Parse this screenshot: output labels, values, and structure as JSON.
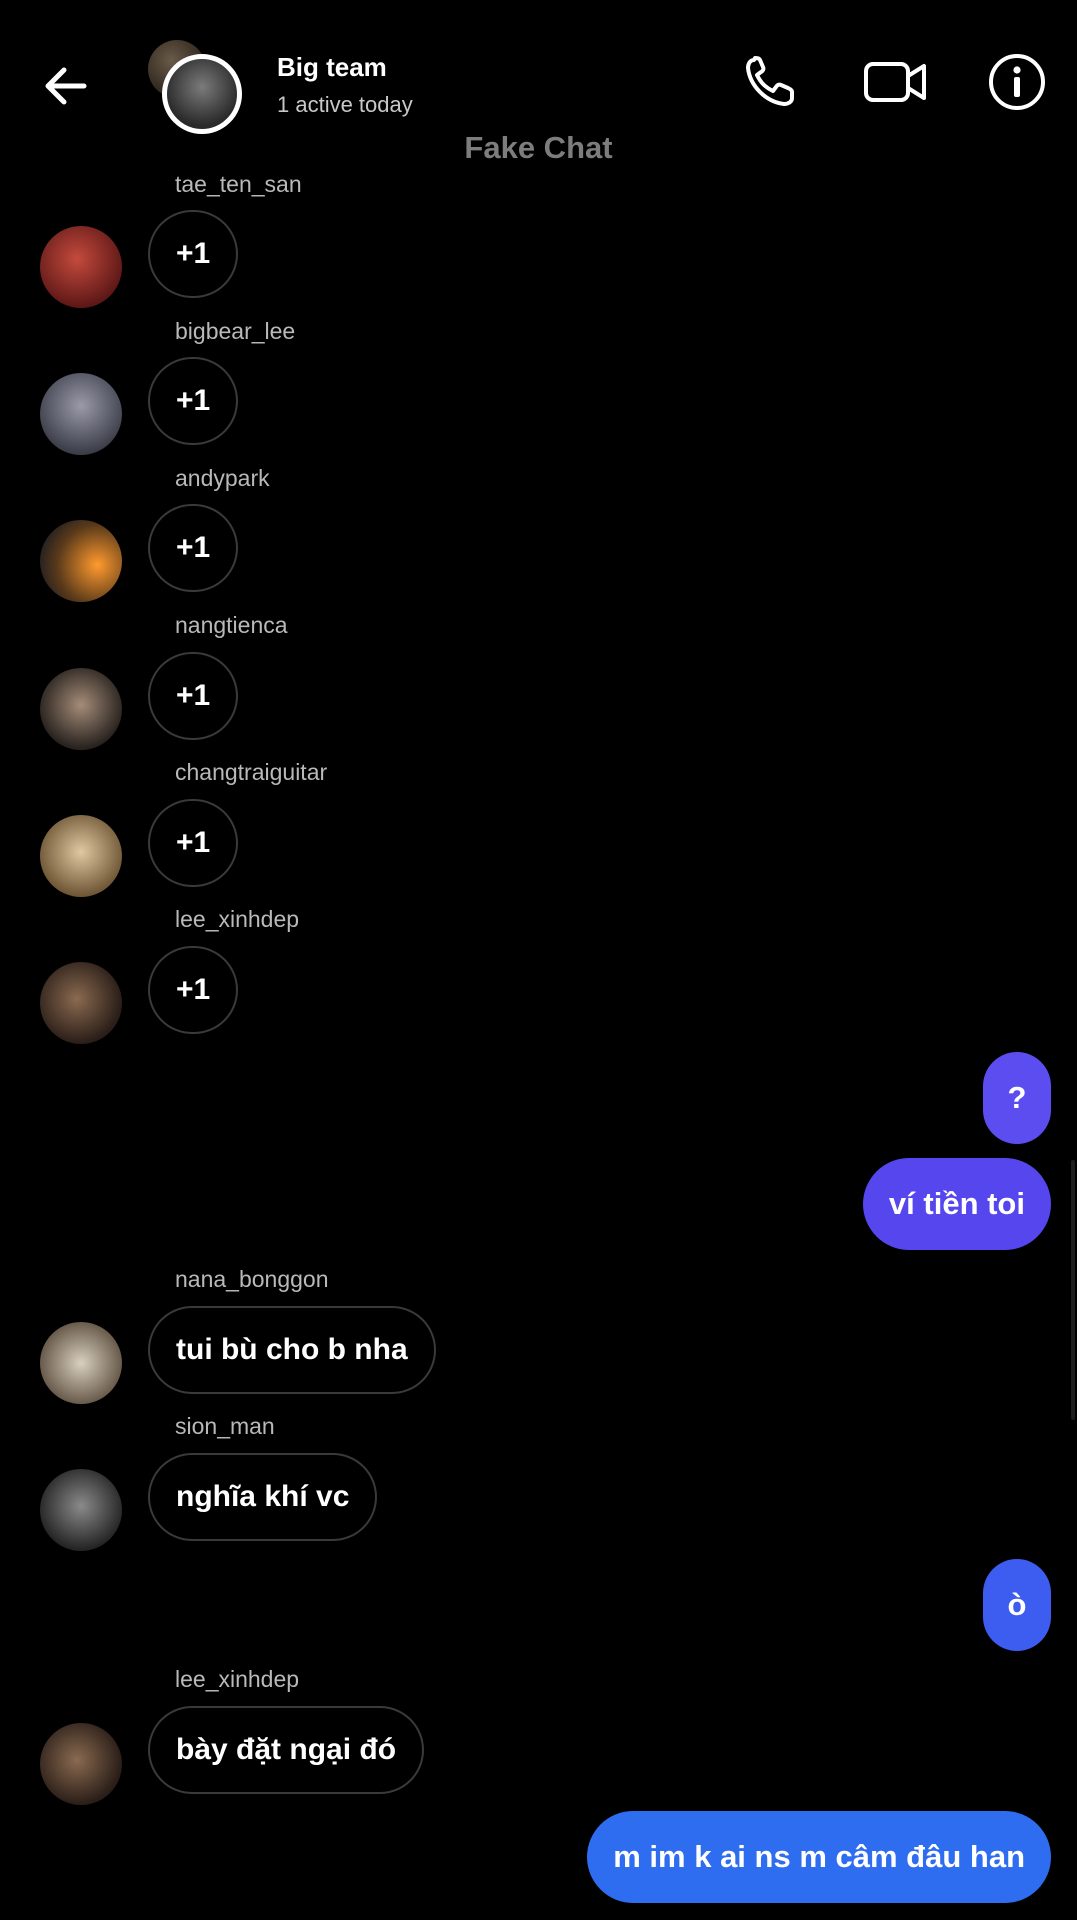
{
  "header": {
    "title": "Big team",
    "subtitle": "1 active today",
    "watermark": "Fake Chat",
    "icons": [
      "back-arrow-icon",
      "phone-icon",
      "video-icon",
      "info-icon"
    ]
  },
  "messages": [
    {
      "sender": "tae_ten_san",
      "text": "+1",
      "avatar_color": "#8a2c2c"
    },
    {
      "sender": "bigbear_lee",
      "text": "+1",
      "avatar_color": "#5c5f6e"
    },
    {
      "sender": "andypark",
      "text": "+1",
      "avatar_color": "#b86a1c"
    },
    {
      "sender": "nangtienca",
      "text": "+1",
      "avatar_color": "#3a3530"
    },
    {
      "sender": "changtraiguitar",
      "text": "+1",
      "avatar_color": "#9a7f58"
    },
    {
      "sender": "lee_xinhdep",
      "text": "+1",
      "avatar_color": "#4a3a2e"
    },
    {
      "outgoing": true,
      "text": "?",
      "color": "#5b4df0"
    },
    {
      "outgoing": true,
      "text": "ví tiền toi",
      "color": "#5546ee"
    },
    {
      "sender": "nana_bonggon",
      "text": "tui bù cho b nha",
      "avatar_color": "#7a6c5c"
    },
    {
      "sender": "sion_man",
      "text": "nghĩa khí vc",
      "avatar_color": "#4b4b4b"
    },
    {
      "outgoing": true,
      "text": "ò",
      "color": "#3d5cf0"
    },
    {
      "sender": "lee_xinhdep",
      "text": "bày đặt ngại đó",
      "avatar_color": "#4a3a2e"
    },
    {
      "outgoing": true,
      "text": "m im k ai ns m câm đâu han",
      "color": "#2f6df0"
    }
  ]
}
